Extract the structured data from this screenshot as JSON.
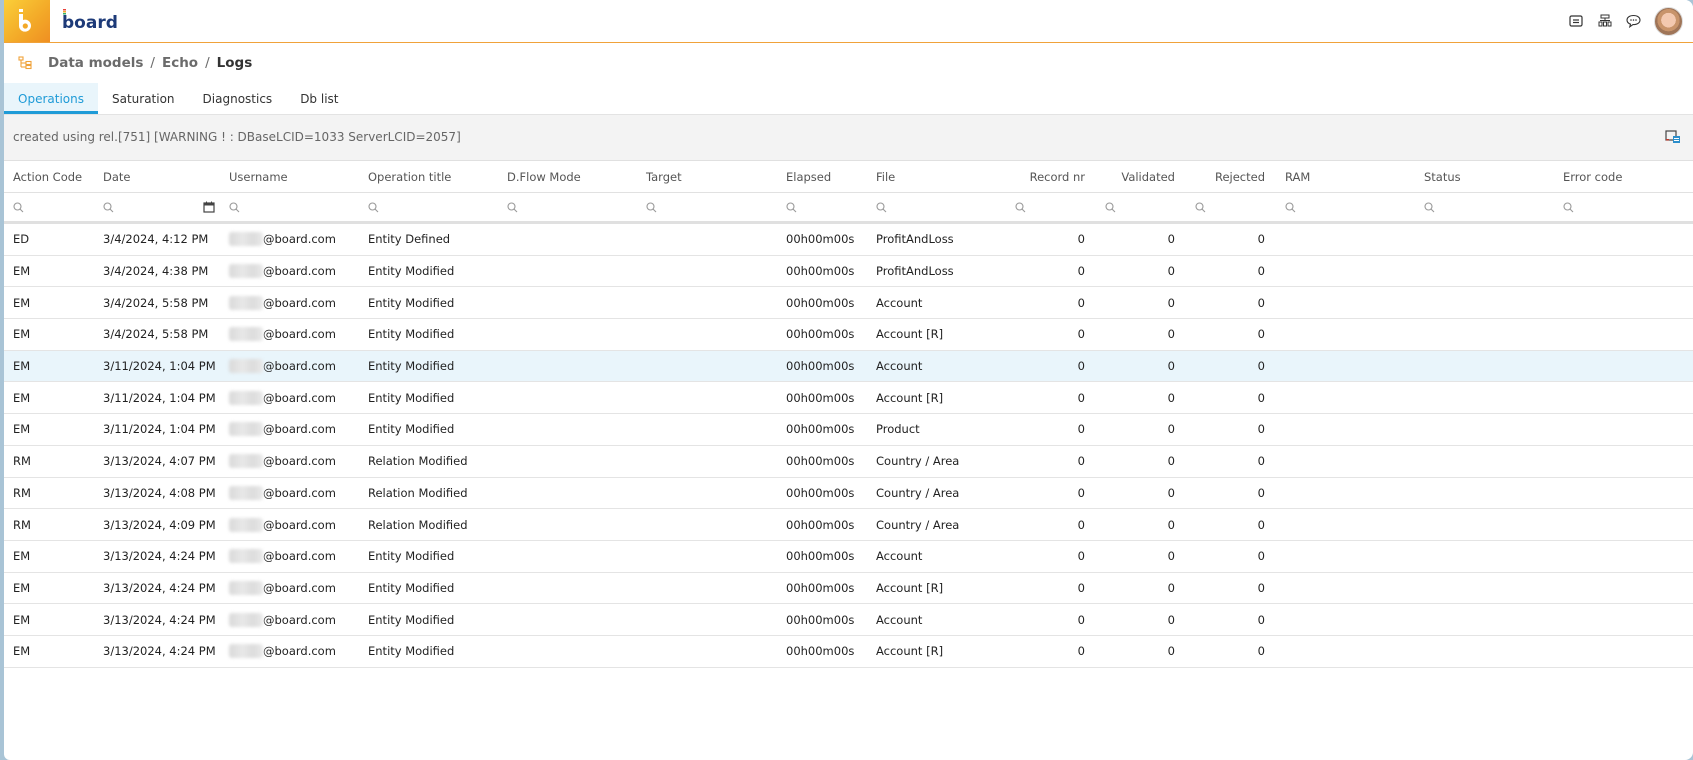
{
  "app": {
    "brand": "board",
    "colors": {
      "accent": "#1f9bd7",
      "brand_orange": "#f3a928",
      "highlight_row": "#e9f5fb"
    }
  },
  "topbar": {
    "icons": [
      "notes-icon",
      "hierarchy-icon",
      "chat-icon"
    ],
    "avatar": "user-avatar"
  },
  "breadcrumb": {
    "icon": "data-model-tree-icon",
    "items": [
      "Data models",
      "Echo",
      "Logs"
    ],
    "separator": "/"
  },
  "tabs": [
    {
      "label": "Operations",
      "active": true
    },
    {
      "label": "Saturation",
      "active": false
    },
    {
      "label": "Diagnostics",
      "active": false
    },
    {
      "label": "Db list",
      "active": false
    }
  ],
  "infobar": {
    "text": "created using rel.[751] [WARNING ! : DBaseLCID=1033 ServerLCID=2057]",
    "export_icon": "export-icon"
  },
  "table": {
    "columns": [
      "Action Code",
      "Date",
      "Username",
      "Operation title",
      "D.Flow Mode",
      "Target",
      "Elapsed",
      "File",
      "Record nr",
      "Validated",
      "Rejected",
      "RAM",
      "Status",
      "Error code"
    ],
    "rows": [
      {
        "action": "ED",
        "date": "3/4/2024, 4:12 PM",
        "user": "@board.com",
        "optitle": "Entity Defined",
        "dflow": "",
        "target": "",
        "elapsed": "00h00m00s",
        "file": "ProfitAndLoss",
        "record": "0",
        "validated": "0",
        "rejected": "0",
        "ram": "",
        "status": "",
        "error": ""
      },
      {
        "action": "EM",
        "date": "3/4/2024, 4:38 PM",
        "user": "@board.com",
        "optitle": "Entity Modified",
        "dflow": "",
        "target": "",
        "elapsed": "00h00m00s",
        "file": "ProfitAndLoss",
        "record": "0",
        "validated": "0",
        "rejected": "0",
        "ram": "",
        "status": "",
        "error": ""
      },
      {
        "action": "EM",
        "date": "3/4/2024, 5:58 PM",
        "user": "@board.com",
        "optitle": "Entity Modified",
        "dflow": "",
        "target": "",
        "elapsed": "00h00m00s",
        "file": "Account",
        "record": "0",
        "validated": "0",
        "rejected": "0",
        "ram": "",
        "status": "",
        "error": ""
      },
      {
        "action": "EM",
        "date": "3/4/2024, 5:58 PM",
        "user": "@board.com",
        "optitle": "Entity Modified",
        "dflow": "",
        "target": "",
        "elapsed": "00h00m00s",
        "file": "Account [R]",
        "record": "0",
        "validated": "0",
        "rejected": "0",
        "ram": "",
        "status": "",
        "error": ""
      },
      {
        "action": "EM",
        "date": "3/11/2024, 1:04 PM",
        "user": "@board.com",
        "optitle": "Entity Modified",
        "dflow": "",
        "target": "",
        "elapsed": "00h00m00s",
        "file": "Account",
        "record": "0",
        "validated": "0",
        "rejected": "0",
        "ram": "",
        "status": "",
        "error": "",
        "highlighted": true
      },
      {
        "action": "EM",
        "date": "3/11/2024, 1:04 PM",
        "user": "@board.com",
        "optitle": "Entity Modified",
        "dflow": "",
        "target": "",
        "elapsed": "00h00m00s",
        "file": "Account [R]",
        "record": "0",
        "validated": "0",
        "rejected": "0",
        "ram": "",
        "status": "",
        "error": ""
      },
      {
        "action": "EM",
        "date": "3/11/2024, 1:04 PM",
        "user": "@board.com",
        "optitle": "Entity Modified",
        "dflow": "",
        "target": "",
        "elapsed": "00h00m00s",
        "file": "Product",
        "record": "0",
        "validated": "0",
        "rejected": "0",
        "ram": "",
        "status": "",
        "error": ""
      },
      {
        "action": "RM",
        "date": "3/13/2024, 4:07 PM",
        "user": "@board.com",
        "optitle": "Relation Modified",
        "dflow": "",
        "target": "",
        "elapsed": "00h00m00s",
        "file": "Country / Area",
        "record": "0",
        "validated": "0",
        "rejected": "0",
        "ram": "",
        "status": "",
        "error": ""
      },
      {
        "action": "RM",
        "date": "3/13/2024, 4:08 PM",
        "user": "@board.com",
        "optitle": "Relation Modified",
        "dflow": "",
        "target": "",
        "elapsed": "00h00m00s",
        "file": "Country / Area",
        "record": "0",
        "validated": "0",
        "rejected": "0",
        "ram": "",
        "status": "",
        "error": ""
      },
      {
        "action": "RM",
        "date": "3/13/2024, 4:09 PM",
        "user": "@board.com",
        "optitle": "Relation Modified",
        "dflow": "",
        "target": "",
        "elapsed": "00h00m00s",
        "file": "Country / Area",
        "record": "0",
        "validated": "0",
        "rejected": "0",
        "ram": "",
        "status": "",
        "error": ""
      },
      {
        "action": "EM",
        "date": "3/13/2024, 4:24 PM",
        "user": "@board.com",
        "optitle": "Entity Modified",
        "dflow": "",
        "target": "",
        "elapsed": "00h00m00s",
        "file": "Account",
        "record": "0",
        "validated": "0",
        "rejected": "0",
        "ram": "",
        "status": "",
        "error": ""
      },
      {
        "action": "EM",
        "date": "3/13/2024, 4:24 PM",
        "user": "@board.com",
        "optitle": "Entity Modified",
        "dflow": "",
        "target": "",
        "elapsed": "00h00m00s",
        "file": "Account [R]",
        "record": "0",
        "validated": "0",
        "rejected": "0",
        "ram": "",
        "status": "",
        "error": ""
      },
      {
        "action": "EM",
        "date": "3/13/2024, 4:24 PM",
        "user": "@board.com",
        "optitle": "Entity Modified",
        "dflow": "",
        "target": "",
        "elapsed": "00h00m00s",
        "file": "Account",
        "record": "0",
        "validated": "0",
        "rejected": "0",
        "ram": "",
        "status": "",
        "error": ""
      },
      {
        "action": "EM",
        "date": "3/13/2024, 4:24 PM",
        "user": "@board.com",
        "optitle": "Entity Modified",
        "dflow": "",
        "target": "",
        "elapsed": "00h00m00s",
        "file": "Account [R]",
        "record": "0",
        "validated": "0",
        "rejected": "0",
        "ram": "",
        "status": "",
        "error": ""
      }
    ]
  }
}
